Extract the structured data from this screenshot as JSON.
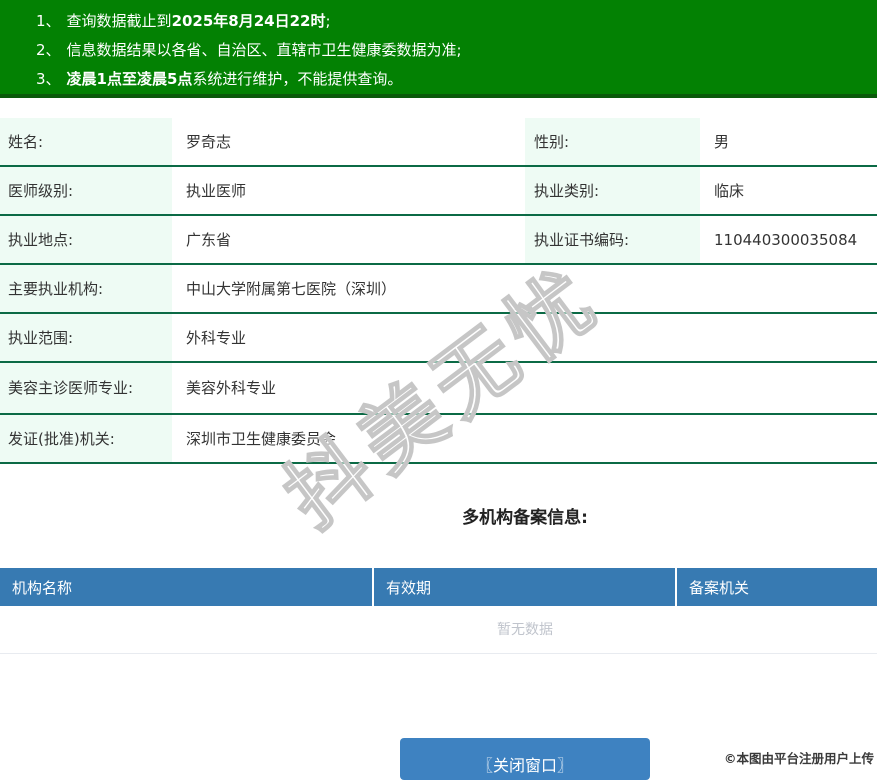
{
  "banner": {
    "items": [
      {
        "num": "1、",
        "segments": [
          {
            "text": "查询数据截止到",
            "bold": false
          },
          {
            "text": "2025年8月24日22时",
            "bold": true
          },
          {
            "text": ";",
            "bold": false
          }
        ]
      },
      {
        "num": "2、",
        "segments": [
          {
            "text": "信息数据结果以各省、自治区、直辖市卫生健康委数据为准;",
            "bold": false
          }
        ]
      },
      {
        "num": "3、",
        "segments": [
          {
            "text": "凌晨1点至凌晨5点",
            "bold": true
          },
          {
            "text": "系统进行维护，不能提供查询。",
            "bold": false
          }
        ]
      }
    ]
  },
  "profile": {
    "rows": [
      {
        "cells": [
          {
            "label": "姓名:",
            "value": "罗奇志"
          },
          {
            "label": "性别:",
            "value": "男"
          }
        ]
      },
      {
        "cells": [
          {
            "label": "医师级别:",
            "value": "执业医师"
          },
          {
            "label": "执业类别:",
            "value": "临床"
          }
        ]
      },
      {
        "cells": [
          {
            "label": "执业地点:",
            "value": "广东省"
          },
          {
            "label": "执业证书编码:",
            "value": "110440300035084"
          }
        ]
      },
      {
        "cells": [
          {
            "label": "主要执业机构:",
            "value": "中山大学附属第七医院（深圳）"
          }
        ]
      },
      {
        "cells": [
          {
            "label": "执业范围:",
            "value": "外科专业"
          }
        ]
      },
      {
        "cells": [
          {
            "label": "美容主诊医师专业:",
            "value": "美容外科专业"
          }
        ]
      },
      {
        "cells": [
          {
            "label": "发证(批准)机关:",
            "value": "深圳市卫生健康委员会"
          }
        ]
      }
    ]
  },
  "filing": {
    "title": "多机构备案信息:",
    "columns": [
      "机构名称",
      "有效期",
      "备案机关"
    ],
    "empty_text": "暂无数据"
  },
  "close_button_label": "〖关闭窗口〗",
  "watermark_text": "抖美无忧",
  "copyright_text": "©本图由平台注册用户上传",
  "colors": {
    "banner_green": "#038103",
    "banner_border": "#0a5a0a",
    "row_divider_green": "#0b6a45",
    "label_mint": "#eefbf4",
    "table_header_blue": "#377ab2",
    "button_blue": "#3e82c1",
    "empty_text_gray": "#c0c4cc"
  }
}
